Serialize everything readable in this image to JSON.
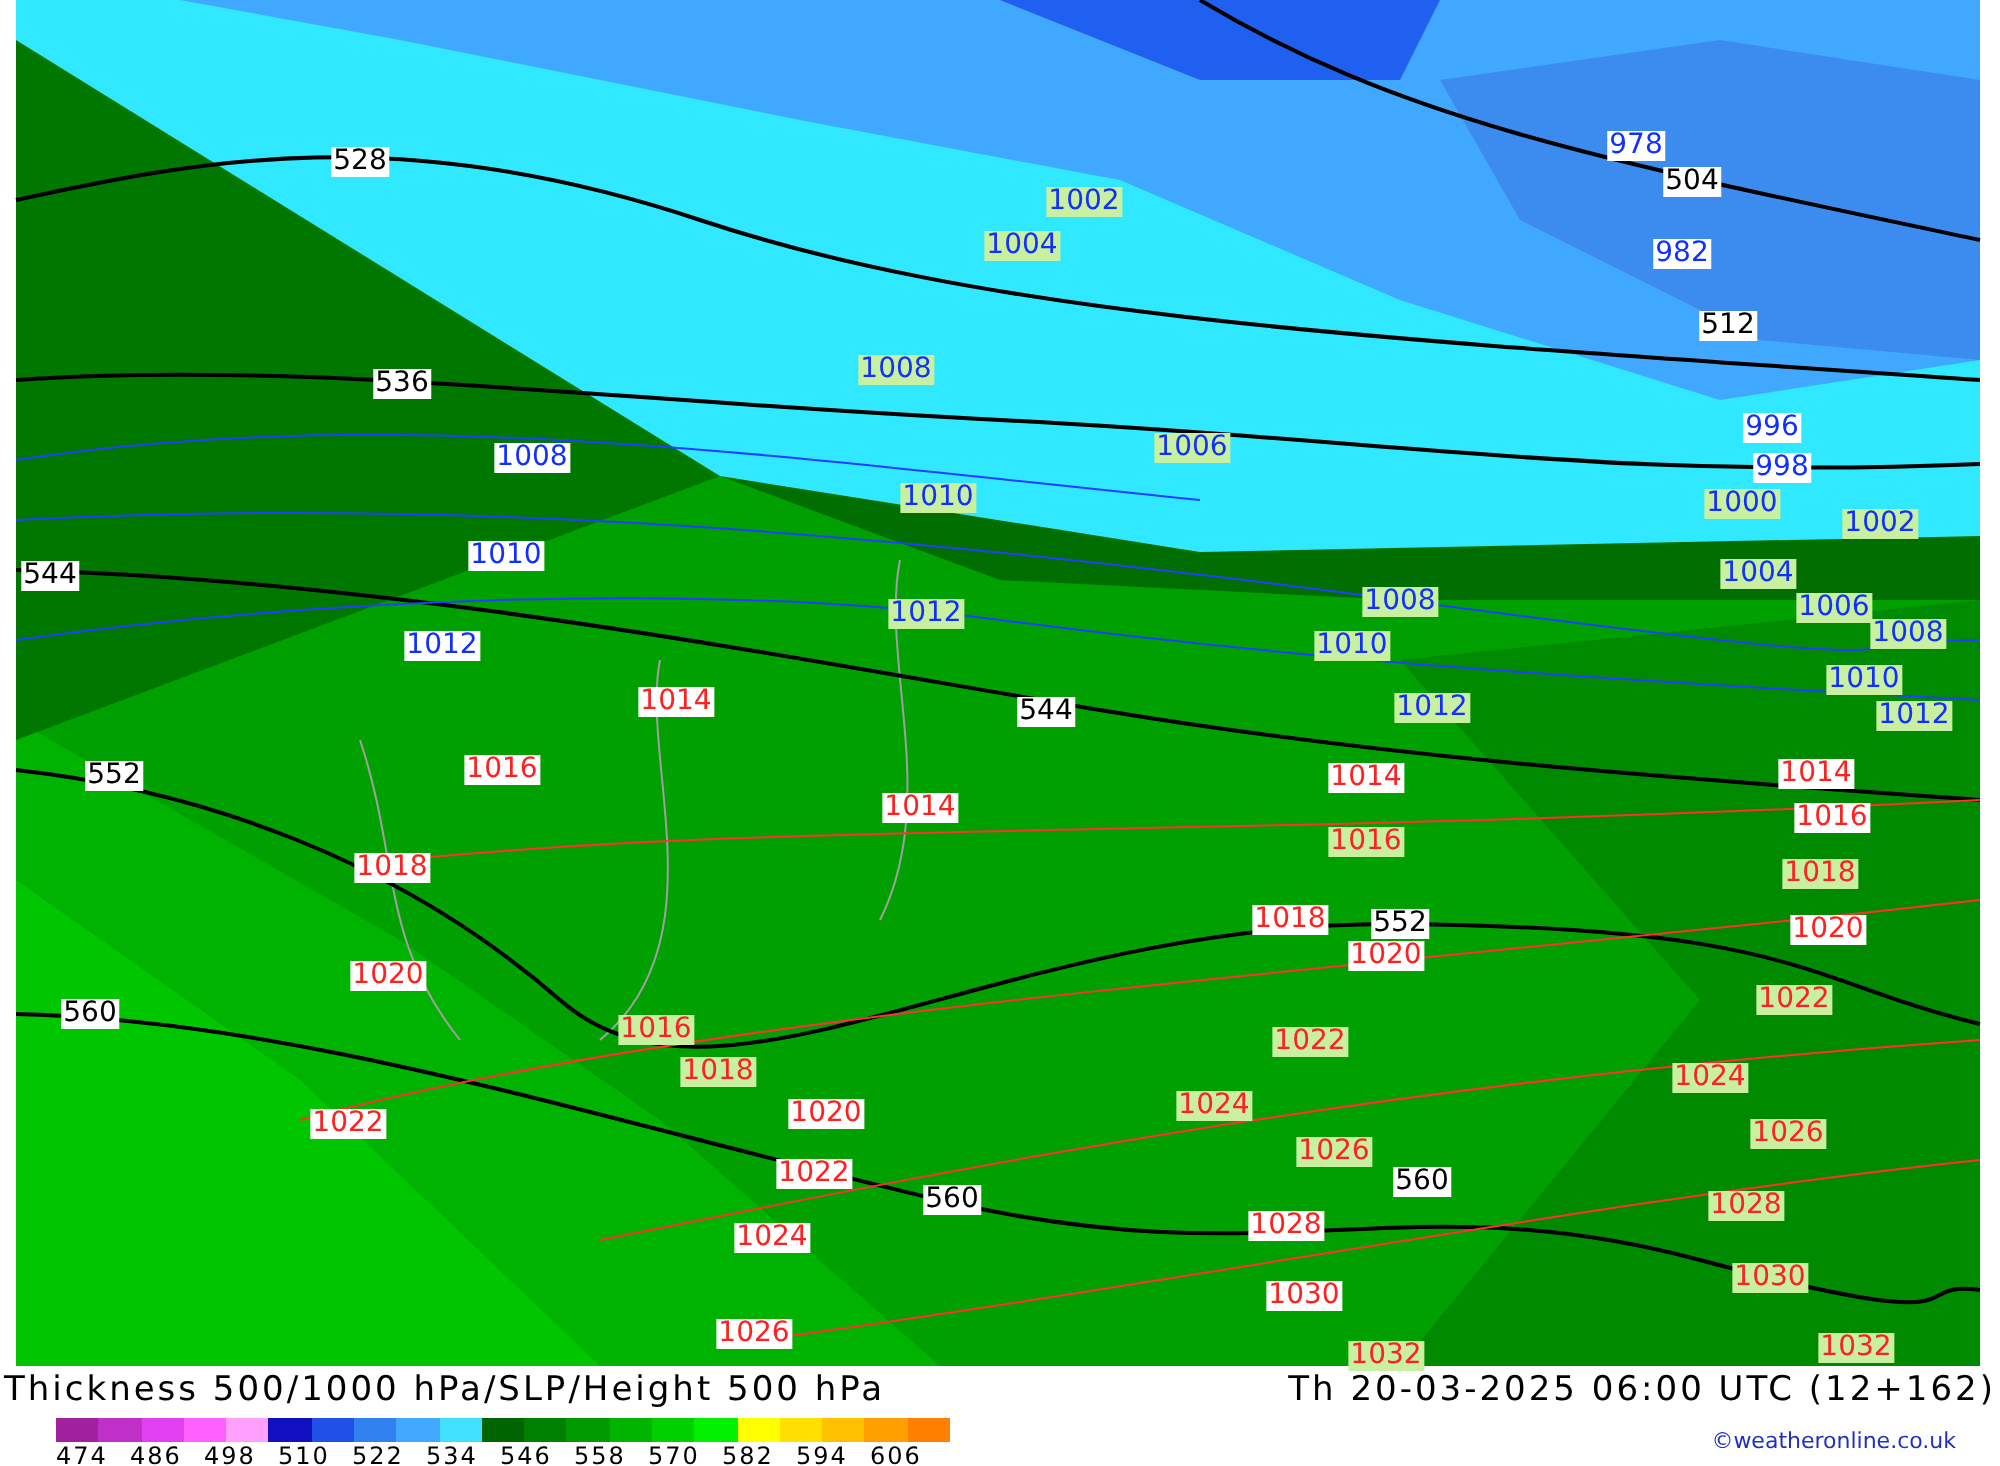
{
  "map": {
    "labels": [
      {
        "text": "528",
        "kind": "height"
      },
      {
        "text": "536",
        "kind": "height"
      },
      {
        "text": "544",
        "kind": "height"
      },
      {
        "text": "544",
        "kind": "height"
      },
      {
        "text": "552",
        "kind": "height"
      },
      {
        "text": "560",
        "kind": "height"
      },
      {
        "text": "560",
        "kind": "height"
      },
      {
        "text": "560",
        "kind": "height"
      },
      {
        "text": "504",
        "kind": "height"
      },
      {
        "text": "552",
        "kind": "height"
      },
      {
        "text": "512",
        "kind": "height"
      },
      {
        "text": "978",
        "kind": "low"
      },
      {
        "text": "982",
        "kind": "low"
      },
      {
        "text": "1008",
        "kind": "low"
      },
      {
        "text": "1010",
        "kind": "low"
      },
      {
        "text": "1012",
        "kind": "low"
      },
      {
        "text": "996",
        "kind": "low"
      },
      {
        "text": "998",
        "kind": "low"
      },
      {
        "text": "1002",
        "kind": "low_green"
      },
      {
        "text": "1004",
        "kind": "low_green"
      },
      {
        "text": "1008",
        "kind": "low_green"
      },
      {
        "text": "1006",
        "kind": "low_green"
      },
      {
        "text": "1010",
        "kind": "low_green"
      },
      {
        "text": "1012",
        "kind": "low_green"
      },
      {
        "text": "1008",
        "kind": "low_green"
      },
      {
        "text": "1010",
        "kind": "low_green"
      },
      {
        "text": "1012",
        "kind": "low_green"
      },
      {
        "text": "1000",
        "kind": "low_green"
      },
      {
        "text": "1002",
        "kind": "low_green"
      },
      {
        "text": "1004",
        "kind": "low_green"
      },
      {
        "text": "1006",
        "kind": "low_green"
      },
      {
        "text": "1008",
        "kind": "low_green"
      },
      {
        "text": "1010",
        "kind": "low_green"
      },
      {
        "text": "1012",
        "kind": "low_green"
      },
      {
        "text": "1014",
        "kind": "high"
      },
      {
        "text": "1016",
        "kind": "high"
      },
      {
        "text": "1014",
        "kind": "high"
      },
      {
        "text": "1014",
        "kind": "high"
      },
      {
        "text": "1018",
        "kind": "high"
      },
      {
        "text": "1018",
        "kind": "high"
      },
      {
        "text": "1020",
        "kind": "high"
      },
      {
        "text": "1020",
        "kind": "high"
      },
      {
        "text": "1022",
        "kind": "high"
      },
      {
        "text": "1020",
        "kind": "high"
      },
      {
        "text": "1022",
        "kind": "high"
      },
      {
        "text": "1024",
        "kind": "high"
      },
      {
        "text": "1028",
        "kind": "high"
      },
      {
        "text": "1030",
        "kind": "high"
      },
      {
        "text": "1026",
        "kind": "high"
      },
      {
        "text": "1014",
        "kind": "high"
      },
      {
        "text": "1016",
        "kind": "high"
      },
      {
        "text": "1020",
        "kind": "high"
      },
      {
        "text": "1016",
        "kind": "high_green"
      },
      {
        "text": "1016",
        "kind": "high_green"
      },
      {
        "text": "1018",
        "kind": "high_green"
      },
      {
        "text": "1022",
        "kind": "high_green"
      },
      {
        "text": "1024",
        "kind": "high_green"
      },
      {
        "text": "1026",
        "kind": "high_green"
      },
      {
        "text": "1018",
        "kind": "high_green"
      },
      {
        "text": "1022",
        "kind": "high_green"
      },
      {
        "text": "1024",
        "kind": "high_green"
      },
      {
        "text": "1026",
        "kind": "high_green"
      },
      {
        "text": "1028",
        "kind": "high_green"
      },
      {
        "text": "1030",
        "kind": "high_green"
      },
      {
        "text": "1032",
        "kind": "high_green"
      },
      {
        "text": "1032",
        "kind": "high_green"
      }
    ]
  },
  "title": "Thickness 500/1000 hPa/SLP/Height 500 hPa",
  "valid_time": "Th 20-03-2025 06:00 UTC (12+162)",
  "legend": {
    "swatches": [
      {
        "color": "#a020a0"
      },
      {
        "color": "#c030c8"
      },
      {
        "color": "#e040f0"
      },
      {
        "color": "#ff60ff"
      },
      {
        "color": "#ffa0ff"
      },
      {
        "color": "#1010c0"
      },
      {
        "color": "#2050e8"
      },
      {
        "color": "#3080f0"
      },
      {
        "color": "#40a8ff"
      },
      {
        "color": "#40e0ff"
      },
      {
        "color": "#006400"
      },
      {
        "color": "#008000"
      },
      {
        "color": "#009a00"
      },
      {
        "color": "#00b400"
      },
      {
        "color": "#00d000"
      },
      {
        "color": "#00f000"
      },
      {
        "color": "#ffff00"
      },
      {
        "color": "#ffe000"
      },
      {
        "color": "#ffc000"
      },
      {
        "color": "#ffa000"
      },
      {
        "color": "#ff8000"
      }
    ],
    "ticks": [
      "474",
      "486",
      "498",
      "510",
      "522",
      "534",
      "546",
      "558",
      "570",
      "582",
      "594",
      "606"
    ]
  },
  "copyright": "©weatheronline.co.uk"
}
